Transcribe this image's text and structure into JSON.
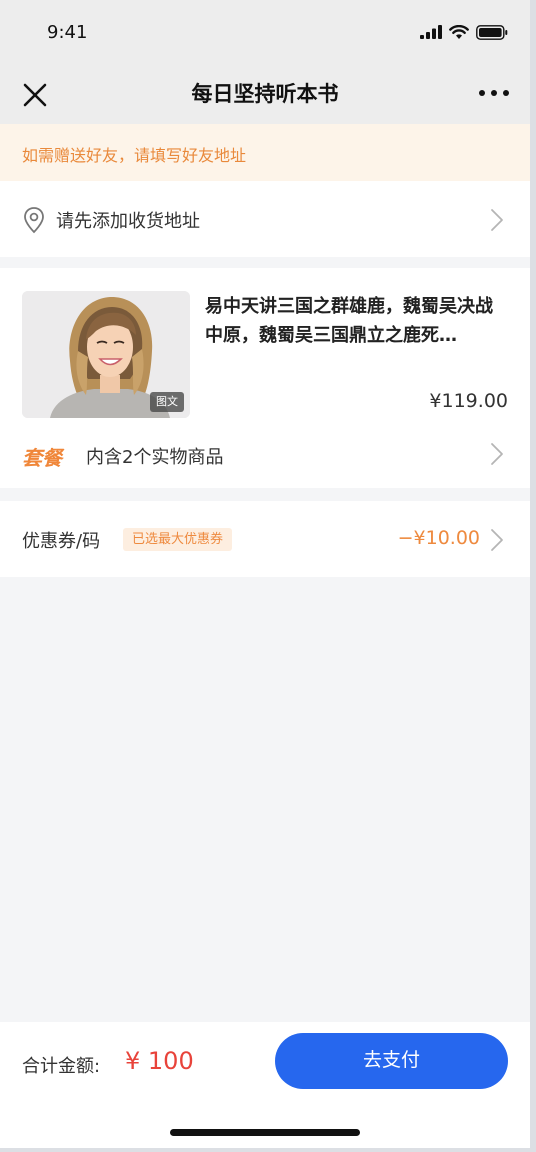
{
  "status": {
    "time": "9:41"
  },
  "nav": {
    "title": "每日坚持听本书"
  },
  "notice": {
    "text": "如需赠送好友，请填写好友地址"
  },
  "address": {
    "placeholder_text": "请先添加收货地址"
  },
  "product": {
    "title": "易中天讲三国之群雄鹿，魏蜀吴决战中原，魏蜀吴三国鼎立之鹿死…",
    "image_tag": "图文",
    "price": "¥119.00",
    "bundle_tag": "套餐",
    "bundle_text": "内含2个实物商品"
  },
  "coupon": {
    "label": "优惠券/码",
    "badge": "已选最大优惠券",
    "value": "−¥10.00"
  },
  "footer": {
    "total_label": "合计金额:",
    "total_value": "¥ 100",
    "pay_label": "去支付"
  },
  "colors": {
    "accent_orange": "#ee8a3f",
    "price_red": "#e8433a",
    "primary_blue": "#2667ee",
    "notice_bg": "#fdf4e9"
  },
  "icons": [
    "close-icon",
    "more-icon",
    "location-pin-icon",
    "chevron-right-icon",
    "signal-icon",
    "wifi-icon",
    "battery-icon"
  ]
}
